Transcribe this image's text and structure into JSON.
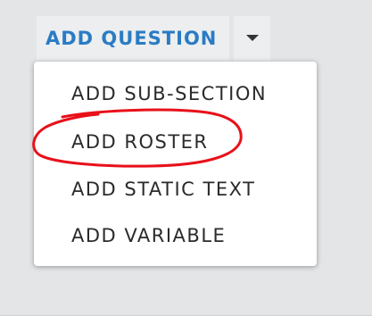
{
  "toolbar": {
    "add_question_label": "ADD QUESTION",
    "caret_icon": "caret-down-icon"
  },
  "menu": {
    "items": [
      {
        "label": "ADD SUB-SECTION"
      },
      {
        "label": "ADD ROSTER"
      },
      {
        "label": "ADD STATIC TEXT"
      },
      {
        "label": "ADD VARIABLE"
      }
    ]
  },
  "colors": {
    "accent": "#2a7bc4",
    "annotation": "#e8101a",
    "background": "#e3e5e7"
  },
  "annotation": {
    "shape": "freehand-circle",
    "target": "ADD ROSTER"
  }
}
